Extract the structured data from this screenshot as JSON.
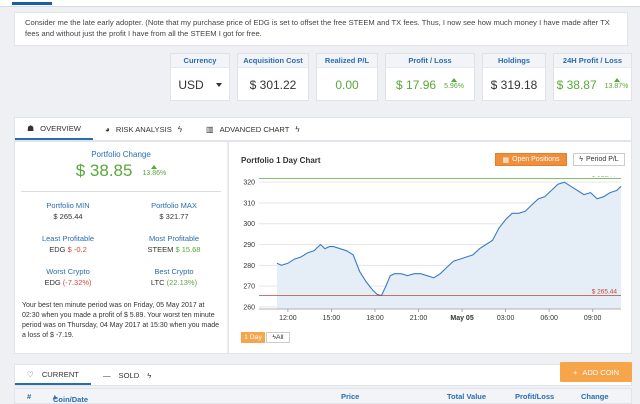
{
  "intro_text": "Consider me the late early adopter. (Note that my purchase price of EDG is set to offset the free STEEM and TX fees. Thus, I now see how much money I have made after TX fees and without just the profit I have from all the STEEM I got for free.",
  "cards": {
    "currency": {
      "label": "Currency",
      "value": "USD"
    },
    "acquisition": {
      "label": "Acquisition Cost",
      "value": "$ 301.22"
    },
    "realized": {
      "label": "Realized P/L",
      "value": "0.00"
    },
    "profit": {
      "label": "Profit / Loss",
      "value": "$ 17.96",
      "pct": "5.96%"
    },
    "holdings": {
      "label": "Holdings",
      "value": "$ 319.18"
    },
    "profit24": {
      "label": "24H Profit / Loss",
      "value": "$ 38.87",
      "pct": "13.87%"
    }
  },
  "tabs": [
    {
      "label": "OVERVIEW"
    },
    {
      "label": "RISK ANALYSIS"
    },
    {
      "label": "ADVANCED CHART"
    }
  ],
  "portfolio": {
    "change_label": "Portfolio Change",
    "change_value": "$ 38.85",
    "change_pct": "13.86%",
    "min_label": "Portfolio MIN",
    "min_value": "$ 265.44",
    "max_label": "Portfolio MAX",
    "max_value": "$ 321.77",
    "least_label": "Least Profitable",
    "least_coin": "EDG",
    "least_value": "$ -0.2",
    "most_label": "Most Profitable",
    "most_coin": "STEEM",
    "most_value": "$ 15.68",
    "worst_label": "Worst Crypto",
    "worst_coin": "EDG",
    "worst_value": "(-7.32%)",
    "best_label": "Best Crypto",
    "best_coin": "LTC",
    "best_value": "(22.13%)",
    "note": "Your best ten minute period was on Friday, 05 May 2017 at 02:30 when you made a profit of $ 5.89. Your worst ten minute period was on Thursday, 04 May 2017 at 15:30 when you made a loss of $ -7.19."
  },
  "chart": {
    "title": "Portfolio 1 Day Chart",
    "btn_open": "Open Positions",
    "btn_period": "Period P/L",
    "range_day": "1 Day",
    "range_all": "All"
  },
  "chart_data": {
    "type": "area",
    "title": "Portfolio 1 Day Chart",
    "ylim": [
      259,
      322
    ],
    "yticks": [
      "260",
      "270",
      "280",
      "290",
      "300",
      "310",
      "320"
    ],
    "xticks": [
      "12:00",
      "15:00",
      "18:00",
      "21:00",
      "May 05",
      "03:00",
      "06:00",
      "09:00"
    ],
    "max_label": "$ 321.77",
    "min_label": "$ 265.44",
    "x": [
      0,
      0.1,
      0.25,
      0.4,
      0.55,
      0.7,
      0.85,
      1.0,
      1.1,
      1.2,
      1.3,
      1.45,
      1.6,
      1.75,
      1.9,
      2.05,
      2.2,
      2.3,
      2.4,
      2.5,
      2.6,
      2.7,
      2.85,
      3.0,
      3.15,
      3.3,
      3.45,
      3.6,
      3.75,
      3.9,
      4.05,
      4.2,
      4.35,
      4.5,
      4.65,
      4.8,
      4.95,
      5.1,
      5.25,
      5.4,
      5.55,
      5.7,
      5.85,
      6.0,
      6.15,
      6.3,
      6.45,
      6.6,
      6.75,
      6.9,
      7.05,
      7.2,
      7.35,
      7.5,
      7.65,
      7.8,
      7.9
    ],
    "values": [
      281,
      280,
      281,
      283,
      284,
      286,
      287,
      290,
      288,
      289,
      289,
      288,
      287,
      285,
      277,
      272,
      268,
      266,
      265.5,
      270,
      275,
      276,
      276,
      275,
      276,
      276,
      275,
      274,
      276,
      279,
      282,
      283,
      284,
      285,
      288,
      290,
      292,
      298,
      302,
      305,
      305,
      306,
      309,
      312,
      313,
      316,
      319,
      320,
      318,
      316,
      314,
      315,
      312,
      313,
      315,
      316,
      318
    ],
    "grid": true,
    "xlabel": "",
    "ylabel": ""
  },
  "bottom": {
    "current_label": "CURRENT",
    "sold_label": "SOLD",
    "add_label": "ADD COIN"
  },
  "table": {
    "headers": [
      "#",
      "Coin/Date",
      "Price",
      "Total Value",
      "Profit/Loss",
      "Change"
    ]
  }
}
